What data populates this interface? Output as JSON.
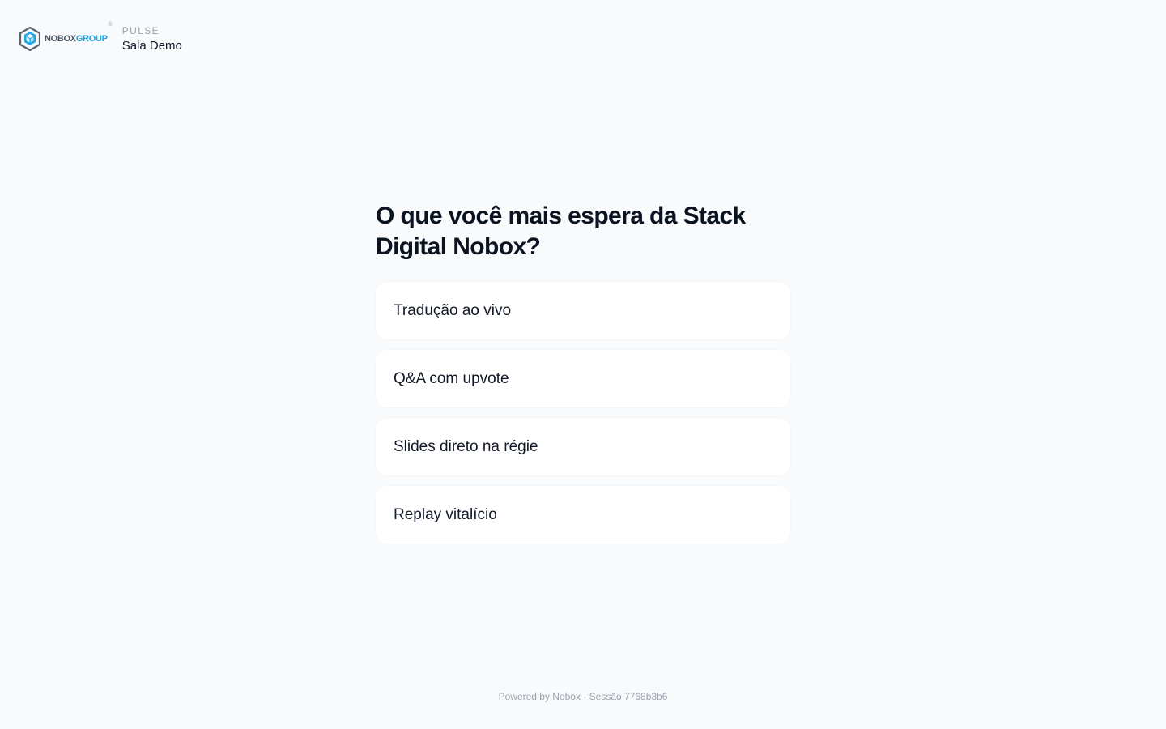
{
  "header": {
    "brand": {
      "word_part1": "NOBOX",
      "word_part2": "GROUP",
      "registered": "®",
      "icon": "nobox-hexagon-logo"
    },
    "room_kicker": "PULSE",
    "room_name": "Sala Demo"
  },
  "poll": {
    "question": "O que você mais espera da Stack Digital Nobox?",
    "options": [
      "Tradução ao vivo",
      "Q&A com upvote",
      "Slides direto na régie",
      "Replay vitalício"
    ]
  },
  "footer": {
    "text": "Powered by Nobox · Sessão 7768b3b6"
  },
  "colors": {
    "background": "#f8fafc",
    "card": "#ffffff",
    "brand_gray": "#4b5563",
    "brand_blue": "#1ea7e1",
    "muted": "#9ca3af"
  }
}
